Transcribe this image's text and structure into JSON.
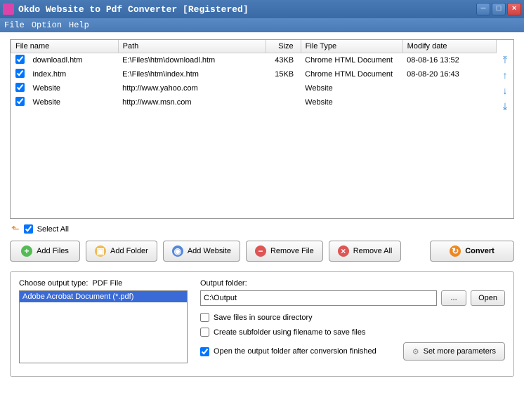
{
  "window": {
    "title": "Okdo Website to Pdf Converter [Registered]"
  },
  "menu": {
    "file": "File",
    "option": "Option",
    "help": "Help"
  },
  "columns": {
    "filename": "File name",
    "path": "Path",
    "size": "Size",
    "filetype": "File Type",
    "modify": "Modify date"
  },
  "files": [
    {
      "checked": true,
      "name": "downloadl.htm",
      "path": "E:\\Files\\htm\\downloadl.htm",
      "size": "43KB",
      "type": "Chrome HTML Document",
      "modify": "08-08-16 13:52"
    },
    {
      "checked": true,
      "name": "index.htm",
      "path": "E:\\Files\\htm\\index.htm",
      "size": "15KB",
      "type": "Chrome HTML Document",
      "modify": "08-08-20 16:43"
    },
    {
      "checked": true,
      "name": "Website",
      "path": "http://www.yahoo.com",
      "size": "",
      "type": "Website",
      "modify": ""
    },
    {
      "checked": true,
      "name": "Website",
      "path": "http://www.msn.com",
      "size": "",
      "type": "Website",
      "modify": ""
    }
  ],
  "selectall": {
    "label": "Select All",
    "checked": true
  },
  "buttons": {
    "add_files": "Add Files",
    "add_folder": "Add Folder",
    "add_website": "Add Website",
    "remove_file": "Remove File",
    "remove_all": "Remove All",
    "convert": "Convert"
  },
  "output": {
    "choose_label": "Choose output type:",
    "type_label": "PDF File",
    "type_item": "Adobe Acrobat Document (*.pdf)",
    "folder_label": "Output folder:",
    "folder_value": "C:\\Output",
    "browse": "...",
    "open": "Open",
    "save_source": {
      "label": "Save files in source directory",
      "checked": false
    },
    "create_sub": {
      "label": "Create subfolder using filename to save files",
      "checked": false
    },
    "open_after": {
      "label": "Open the output folder after conversion finished",
      "checked": true
    },
    "set_params": "Set more parameters"
  }
}
